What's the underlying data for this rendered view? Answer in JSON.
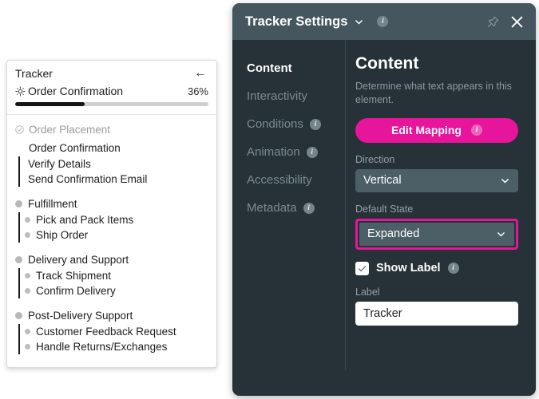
{
  "tracker_card": {
    "title": "Tracker",
    "back_icon": "back-arrow-icon",
    "move_icon": "move-handle-icon",
    "current_stage": "Order Confirmation",
    "progress_percent_label": "36%",
    "progress_percent": 36,
    "groups": [
      {
        "label": "Order Placement",
        "state": "completed",
        "icon": "check-circle-icon",
        "children": []
      },
      {
        "label": "Order Confirmation",
        "state": "current",
        "icon": "none",
        "children": [
          "Verify Details",
          "Send Confirmation Email"
        ]
      },
      {
        "label": "Fulfillment",
        "state": "pending",
        "icon": "dot-icon",
        "children": [
          "Pick and Pack Items",
          "Ship Order"
        ]
      },
      {
        "label": "Delivery and Support",
        "state": "pending",
        "icon": "dot-icon",
        "children": [
          "Track Shipment",
          "Confirm Delivery"
        ]
      },
      {
        "label": "Post-Delivery Support",
        "state": "pending",
        "icon": "dot-icon",
        "children": [
          "Customer Feedback Request",
          "Handle Returns/Exchanges"
        ]
      }
    ]
  },
  "panel": {
    "header": {
      "title": "Tracker Settings",
      "chevron_icon": "chevron-down-icon",
      "info_icon": "info-icon",
      "info_char": "i",
      "pin_icon": "pin-icon",
      "close_icon": "close-icon"
    },
    "nav": [
      {
        "label": "Content",
        "active": true,
        "has_info": false
      },
      {
        "label": "Interactivity",
        "active": false,
        "has_info": false
      },
      {
        "label": "Conditions",
        "active": false,
        "has_info": true
      },
      {
        "label": "Animation",
        "active": false,
        "has_info": true
      },
      {
        "label": "Accessibility",
        "active": false,
        "has_info": false
      },
      {
        "label": "Metadata",
        "active": false,
        "has_info": true
      }
    ],
    "content": {
      "title": "Content",
      "description": "Determine what text appears in this element.",
      "edit_mapping_button": "Edit Mapping",
      "direction_label": "Direction",
      "direction_value": "Vertical",
      "default_state_label": "Default State",
      "default_state_value": "Expanded",
      "show_label_text": "Show Label",
      "show_label_checked": true,
      "label_field_label": "Label",
      "label_field_value": "Tracker",
      "accent_color": "#e6159b"
    }
  }
}
